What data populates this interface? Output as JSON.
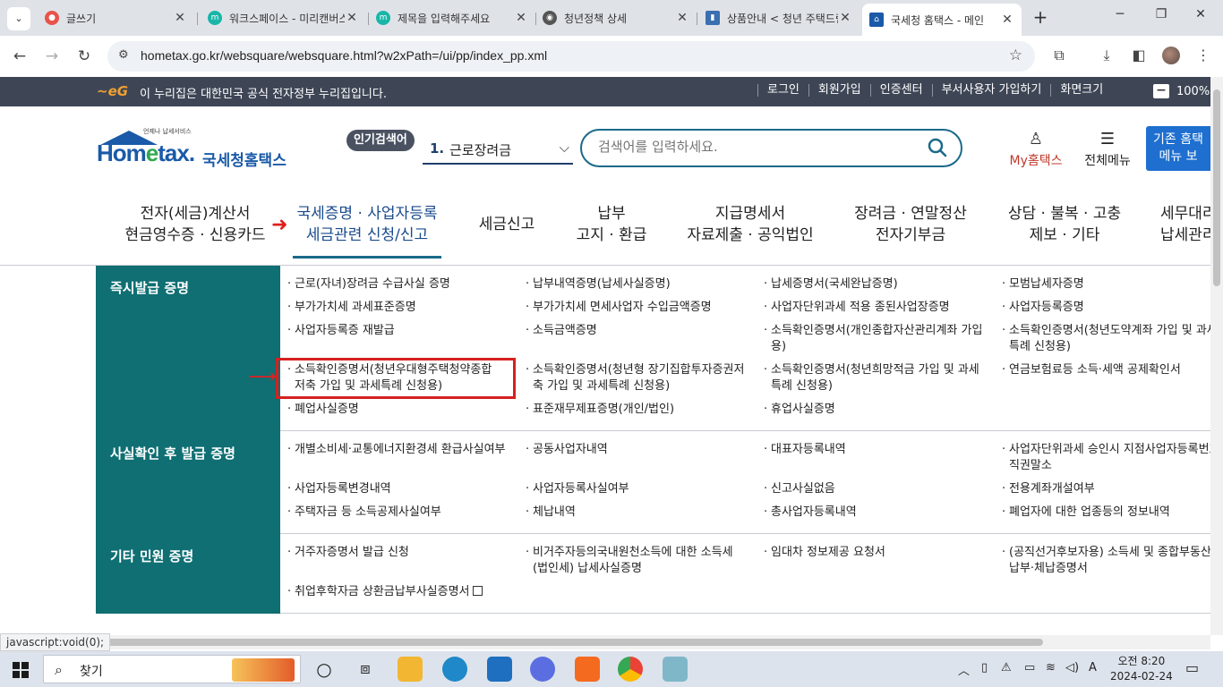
{
  "browser": {
    "tabs": [
      {
        "title": "글쓰기",
        "color": "#e8534a"
      },
      {
        "title": "워크스페이스 - 미리캔버스",
        "color": "#19b6a8"
      },
      {
        "title": "제목을 입력해주세요",
        "color": "#19b6a8"
      },
      {
        "title": "청년정책 상세",
        "color": "#555555"
      },
      {
        "title": "상품안내 < 청년 주택드림",
        "color": "#3a6fb0"
      },
      {
        "title": "국세청 홈택스 - 메인",
        "color": "#1a5aa8"
      }
    ],
    "url": "hometax.go.kr/websquare/websquare.html?w2xPath=/ui/pp/index_pp.xml"
  },
  "govbar": {
    "message": "이 누리집은 대한민국 공식 전자정부 누리집입니다.",
    "links": [
      "로그인",
      "회원가입",
      "인증센터",
      "부서사용자 가입하기",
      "화면크기"
    ],
    "zoom": "100%"
  },
  "header": {
    "logo_small": "언제나 납세서비스",
    "logo_home_a": "Hom",
    "logo_home_e": "e",
    "logo_home_b": "tax.",
    "logo_name": "국세청홈택스",
    "popular_label": "인기검색어",
    "popular_rank": "1.",
    "popular_word": "근로장려금",
    "search_placeholder": "검색어를 입력하세요.",
    "myhome": "My홈택스",
    "allmenu": "전체메뉴",
    "oldmenu_line1": "기존 홈택",
    "oldmenu_line2": "메뉴 보"
  },
  "mainnav": [
    {
      "l1": "전자(세금)계산서",
      "l2": "현금영수증 · 신용카드"
    },
    {
      "l1": "국세증명 · 사업자등록",
      "l2": "세금관련 신청/신고"
    },
    {
      "l1": "세금신고",
      "l2": ""
    },
    {
      "l1": "납부",
      "l2": "고지 · 환급"
    },
    {
      "l1": "지급명세서",
      "l2": "자료제출 · 공익법인"
    },
    {
      "l1": "장려금 · 연말정산",
      "l2": "전자기부금"
    },
    {
      "l1": "상담 · 불복 · 고충",
      "l2": "제보 · 기타"
    },
    {
      "l1": "세무대리",
      "l2": "납세관리"
    }
  ],
  "sections": [
    {
      "title": "즉시발급 증명",
      "items": [
        "근로(자녀)장려금 수급사실 증명",
        "납부내역증명(납세사실증명)",
        "납세증명서(국세완납증명)",
        "모범납세자증명",
        "부가가치세 과세표준증명",
        "부가가치세 면세사업자 수입금액증명",
        "사업자단위과세 적용 종된사업장증명",
        "사업자등록증명",
        "사업자등록증 재발급",
        "소득금액증명",
        "소득확인증명서(개인종합자산관리계좌 가입용)",
        "소득확인증명서(청년도약계좌 가입 및 과세특례 신청용)",
        "소득확인증명서(청년우대형주택청약종합저축 가입 및 과세특례 신청용)",
        "소득확인증명서(청년형 장기집합투자증권저축 가입 및 과세특례 신청용)",
        "소득확인증명서(청년희망적금 가입 및 과세특례 신청용)",
        "연금보험료등 소득·세액 공제확인서",
        "폐업사실증명",
        "표준재무제표증명(개인/법인)",
        "휴업사실증명"
      ]
    },
    {
      "title": "사실확인 후 발급 증명",
      "items": [
        "개별소비세·교통에너지환경세 환급사실여부",
        "공동사업자내역",
        "대표자등록내역",
        "사업자단위과세 승인시 지점사업자등록번호 직권말소",
        "사업자등록변경내역",
        "사업자등록사실여부",
        "신고사실없음",
        "전용계좌개설여부",
        "주택자금 등 소득공제사실여부",
        "체납내역",
        "총사업자등록내역",
        "폐업자에 대한 업종등의 정보내역"
      ]
    },
    {
      "title": "기타 민원 증명",
      "items": [
        "거주자증명서 발급 신청",
        "비거주자등의국내원천소득에 대한 소득세(법인세) 납세사실증명",
        "임대차 정보제공 요청서",
        "(공직선거후보자용) 소득세 및 종합부동산세 납부·체납증명서",
        "취업후학자금 상환금납부사실증명서"
      ]
    }
  ],
  "status_url": "javascript:void(0);",
  "taskbar": {
    "search_label": "찾기",
    "time": "오전 8:20",
    "date": "2024-02-24"
  }
}
